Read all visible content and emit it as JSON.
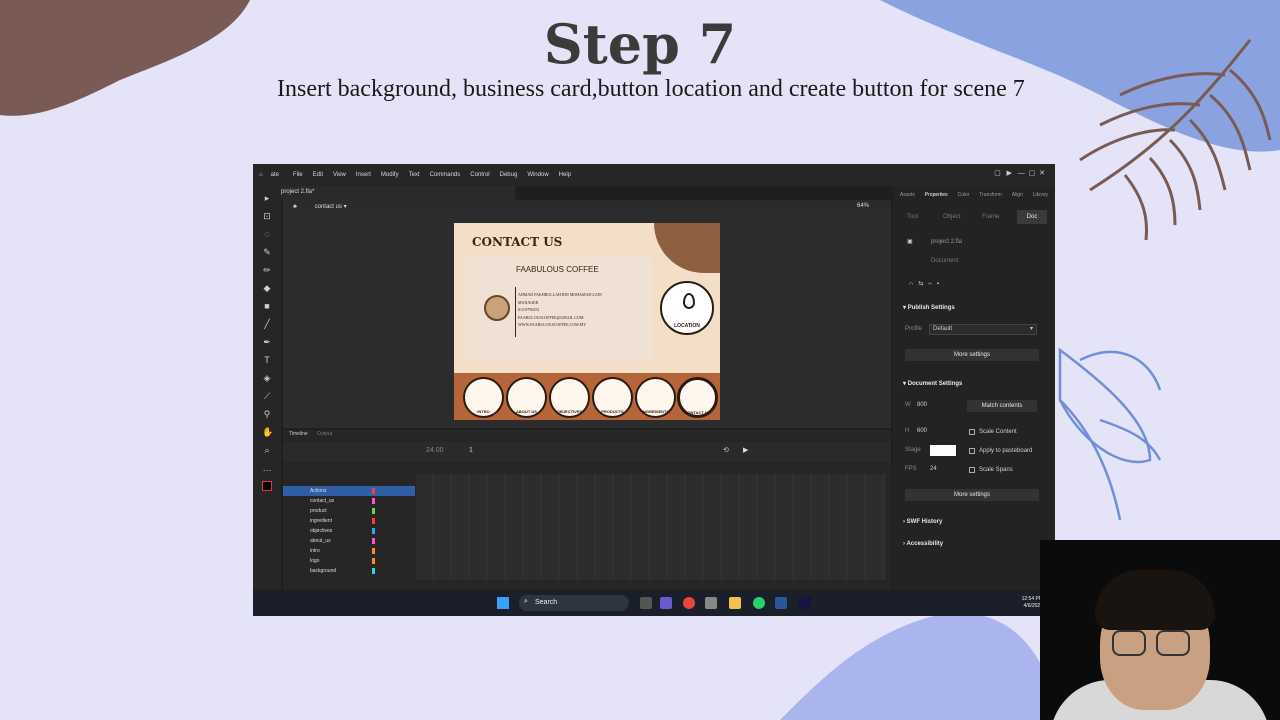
{
  "slide": {
    "title": "Step 7",
    "subtitle": "Insert background, business card,button location and create button for scene 7"
  },
  "colors": {
    "slide_bg": "#e4e3f7",
    "blob": "#7a5a55",
    "accent_blue": "#6f8fd8",
    "leaf": "#7a5a55"
  },
  "app": {
    "name": "Adobe Animate",
    "doc_tab": "project 2.fla*",
    "menus": [
      "File",
      "Edit",
      "View",
      "Insert",
      "Modify",
      "Text",
      "Commands",
      "Control",
      "Debug",
      "Window",
      "Help"
    ],
    "scene_label": "contact us",
    "zoom": "64%"
  },
  "stage": {
    "heading": "CONTACT US",
    "card_title": "FAABULOUS COFFEE",
    "info_lines": [
      "AHMAD FAKHRULLAH BIN MOHAMAD ZAIN",
      "MANAGER",
      "013-8796352",
      "FAABULOUSCOFFEE@GMAIL.COM",
      "WWW.FAABULOUSCOFFEE.COM.MY"
    ],
    "location_label": "LOCATION",
    "buttons": [
      "INTRO",
      "ABOUT US",
      "OBJECTIVES",
      "PRODUCTS",
      "INGREDIENTS",
      "CONTACT US"
    ]
  },
  "properties": {
    "tabs": [
      "Assets",
      "Properties",
      "Color",
      "Transform",
      "Align",
      "Library"
    ],
    "subtabs": [
      "Tool",
      "Object",
      "Frame",
      "Doc"
    ],
    "file": "project 2.fla",
    "file_type": "Document",
    "publish_settings": "Publish Settings",
    "profile_label": "Profile",
    "profile_value": "Default",
    "more_settings": "More settings",
    "document_settings": "Document Settings",
    "width_label": "W",
    "width": "800",
    "height_label": "H",
    "height": "600",
    "match_contents": "Match contents",
    "scale_content": "Scale Content",
    "stage_label": "Stage",
    "apply_pasteboard": "Apply to pasteboard",
    "fps_label": "FPS",
    "fps": "24",
    "scale_spans": "Scale Spans",
    "more_settings2": "More settings",
    "swf_history": "SWF History",
    "accessibility": "Accessibility"
  },
  "timeline": {
    "tabs": [
      "Timeline",
      "Output"
    ],
    "fps_readout": "24.00",
    "frame": "1",
    "layers": [
      "Actions",
      "contact_us",
      "product",
      "ingredient",
      "objectives",
      "about_us",
      "intro",
      "logo",
      "background"
    ],
    "layer_colors": [
      "#ff3b3b",
      "#ff4fd8",
      "#6bd43a",
      "#ff3b3b",
      "#3aa0ff",
      "#ff4fd8",
      "#ff8a1f",
      "#ff8a1f",
      "#2fd6e0"
    ]
  },
  "taskbar": {
    "search": "Search",
    "time": "12:54 PM",
    "date": "4/6/2023"
  }
}
